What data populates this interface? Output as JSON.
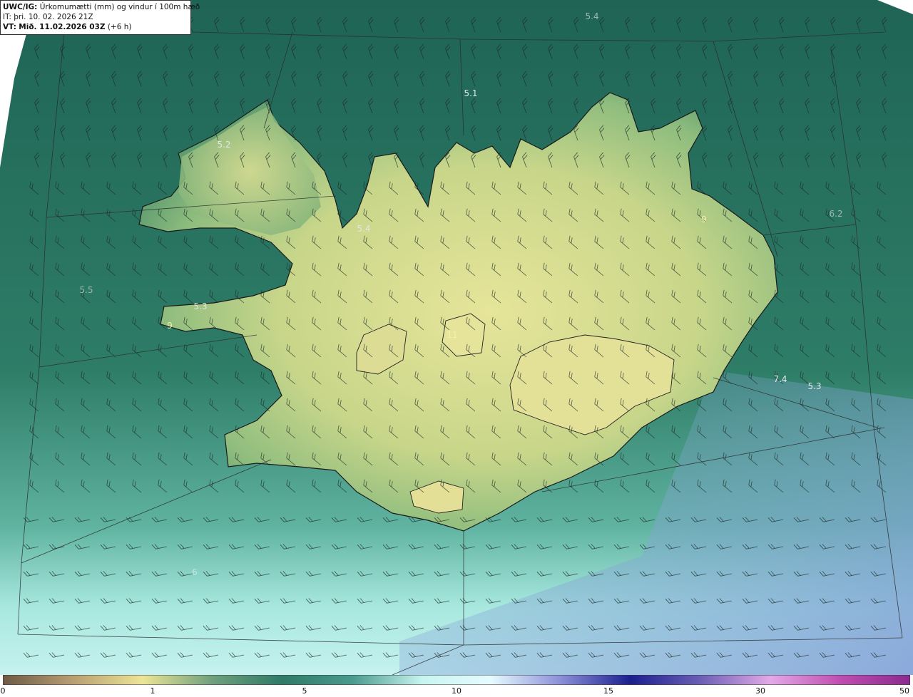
{
  "header": {
    "line1_title": "UWC/IG:",
    "line1_rest": "Úrkomumætti (mm) og vindur í 100m hæð",
    "line2_label": "IT:",
    "line2_value": "þri. 10. 02. 2026 21Z",
    "line3_label": "VT:",
    "line3_value": "Mið. 11.02.2026 03Z",
    "line3_suffix": "(+6 h)"
  },
  "map_labels": [
    "5.4",
    "5.1",
    "5.2",
    "5.4",
    "5.5",
    "5.3",
    "6.2",
    "7.4",
    "5.3",
    "9",
    "11",
    "9",
    "6"
  ],
  "colorbar": {
    "ticks": [
      "0",
      "1",
      "5",
      "10",
      "15",
      "30",
      "50"
    ],
    "colors": [
      "#6e5a45",
      "#b89e72",
      "#ede596",
      "#6fa07c",
      "#2f7a68",
      "#4a9a8e",
      "#c7f5ef",
      "#e6fbff",
      "#8b8fd8",
      "#1b1f8e",
      "#6b5fb5",
      "#e3a9e6",
      "#c04db0",
      "#8a2a8f"
    ]
  },
  "colors": {
    "sea_dark": "#1f6455",
    "sea_mid": "#3c8a74",
    "sea_light": "#a8e8df",
    "land_low": "#5f9d70",
    "land_high": "#e6e59a"
  },
  "icons": [
    "wind-barb-icon"
  ]
}
